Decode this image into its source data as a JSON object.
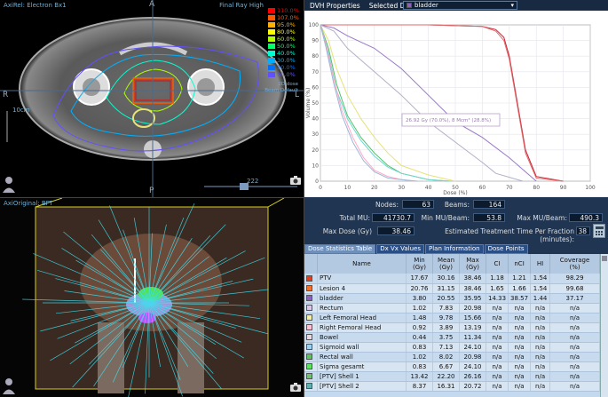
{
  "ct_view": {
    "top_left": "AxiRel: Electron Bx1",
    "top_right": "Final Ray High",
    "orient_top": "A",
    "orient_left": "R",
    "orient_right": "L",
    "orient_bottom": "P",
    "scale_label": "10cm",
    "slice_number": "222",
    "isodose_levels": [
      {
        "label": "110.0%",
        "color": "#ff0000"
      },
      {
        "label": "107.0%",
        "color": "#ff5a00"
      },
      {
        "label": "95.0%",
        "color": "#ffb000"
      },
      {
        "label": "80.0%",
        "color": "#ffff00"
      },
      {
        "label": "60.0%",
        "color": "#b0ff00"
      },
      {
        "label": "50.0%",
        "color": "#00ff66"
      },
      {
        "label": "40.0%",
        "color": "#00ffd0"
      },
      {
        "label": "30.0%",
        "color": "#00b0ff"
      },
      {
        "label": "20.0%",
        "color": "#0070ff"
      },
      {
        "label": "10.0%",
        "color": "#6050ff"
      }
    ],
    "overlay_note_1": "2D dose",
    "overlay_note_2": "Beam Default"
  },
  "view3d": {
    "top_left": "AxiOriginal: BFT"
  },
  "dvh": {
    "panel_title": "DVH Properties",
    "selected_label": "Selected DVH:",
    "selected_value": "bladder",
    "cursor_readout": "26.92 Gy (70.0%), 8 Mcm³ (28.8%)",
    "xlabel": "Dose (%)",
    "ylabel": "Volume (%)"
  },
  "chart_data": {
    "type": "line",
    "xlabel": "Dose (%)",
    "ylabel": "Volume (%)",
    "xlim": [
      0,
      100
    ],
    "ylim": [
      0,
      100
    ],
    "x_ticks": [
      0,
      10,
      20,
      30,
      40,
      50,
      60,
      70,
      80,
      90,
      100
    ],
    "y_ticks": [
      0,
      10,
      20,
      30,
      40,
      50,
      60,
      70,
      80,
      90,
      100
    ],
    "series": [
      {
        "color": "#cc2233",
        "x": [
          0,
          40,
          60,
          65,
          68,
          70,
          73,
          76,
          80,
          90
        ],
        "y": [
          100,
          100,
          99,
          97,
          92,
          80,
          50,
          20,
          3,
          0
        ]
      },
      {
        "color": "#e06a6a",
        "x": [
          0,
          40,
          60,
          65,
          68,
          70,
          73,
          76,
          80,
          90
        ],
        "y": [
          100,
          100,
          99,
          96,
          90,
          78,
          48,
          18,
          2,
          0
        ]
      },
      {
        "color": "#9a78c8",
        "x": [
          0,
          5,
          10,
          20,
          30,
          40,
          50,
          60,
          70,
          80
        ],
        "y": [
          100,
          98,
          93,
          85,
          72,
          55,
          38,
          28,
          15,
          0
        ]
      },
      {
        "color": "#b0b0c8",
        "x": [
          0,
          5,
          10,
          20,
          30,
          40,
          50,
          60,
          65,
          75
        ],
        "y": [
          100,
          96,
          85,
          70,
          55,
          38,
          25,
          12,
          5,
          0
        ]
      },
      {
        "color": "#e7e27a",
        "x": [
          0,
          3,
          6,
          10,
          15,
          20,
          25,
          30,
          40,
          50
        ],
        "y": [
          100,
          90,
          72,
          55,
          40,
          28,
          18,
          10,
          4,
          0
        ]
      },
      {
        "color": "#4fbf6a",
        "x": [
          0,
          3,
          6,
          10,
          15,
          20,
          25,
          30,
          40,
          48
        ],
        "y": [
          100,
          85,
          62,
          42,
          28,
          18,
          10,
          5,
          1,
          0
        ]
      },
      {
        "color": "#6fd6d0",
        "x": [
          0,
          3,
          6,
          10,
          15,
          20,
          25,
          30,
          40,
          48
        ],
        "y": [
          100,
          82,
          58,
          40,
          26,
          16,
          9,
          5,
          1,
          0
        ]
      },
      {
        "color": "#ffa8c8",
        "x": [
          0,
          2,
          5,
          8,
          12,
          16,
          20,
          25,
          30,
          35
        ],
        "y": [
          100,
          88,
          65,
          45,
          28,
          15,
          7,
          3,
          1,
          0
        ]
      },
      {
        "color": "#9bb8d8",
        "x": [
          0,
          2,
          5,
          8,
          12,
          16,
          20,
          25,
          30,
          36
        ],
        "y": [
          100,
          86,
          62,
          42,
          25,
          13,
          6,
          2,
          1,
          0
        ]
      }
    ]
  },
  "stats": {
    "nodes_label": "Nodes:",
    "nodes_value": "63",
    "beams_label": "Beams:",
    "beams_value": "164",
    "total_mu_label": "Total MU:",
    "total_mu_value": "41730.7",
    "min_mu_label": "Min MU/Beam:",
    "min_mu_value": "53.8",
    "max_mu_label": "Max MU/Beam:",
    "max_mu_value": "490.3",
    "max_dose_label": "Max Dose (Gy)",
    "max_dose_value": "38.46",
    "ett_label": "Estimated Treatment Time Per Fraction (minutes):",
    "ett_value": "38"
  },
  "tabs": [
    "Dose Statistics Table",
    "Dx Vx Values",
    "Plan Information",
    "Dose Points"
  ],
  "table": {
    "headers": [
      "Name",
      "Min\n(Gy)",
      "Mean\n(Gy)",
      "Max\n(Gy)",
      "CI",
      "nCI",
      "HI",
      "Coverage\n(%)"
    ],
    "rows": [
      {
        "color": "#e04020",
        "name": "PTV",
        "min": "17.67",
        "mean": "30.16",
        "max": "38.46",
        "ci": "1.18",
        "nci": "1.21",
        "hi": "1.54",
        "cov": "98.29"
      },
      {
        "color": "#f07030",
        "name": "Lesion 4",
        "min": "20.76",
        "mean": "31.15",
        "max": "38.46",
        "ci": "1.65",
        "nci": "1.66",
        "hi": "1.54",
        "cov": "99.68"
      },
      {
        "color": "#8a60c0",
        "name": "bladder",
        "min": "3.80",
        "mean": "20.55",
        "max": "35.95",
        "ci": "14.33",
        "nci": "38.57",
        "hi": "1.44",
        "cov": "37.17"
      },
      {
        "color": "#d9c7e8",
        "name": "Rectum",
        "min": "1.02",
        "mean": "7.83",
        "max": "20.98",
        "ci": "n/a",
        "nci": "n/a",
        "hi": "n/a",
        "cov": "n/a"
      },
      {
        "color": "#f5f0a0",
        "name": "Left Femoral Head",
        "min": "1.48",
        "mean": "9.78",
        "max": "15.66",
        "ci": "n/a",
        "nci": "n/a",
        "hi": "n/a",
        "cov": "n/a"
      },
      {
        "color": "#ffc0d0",
        "name": "Right Femoral Head",
        "min": "0.92",
        "mean": "3.89",
        "max": "13.19",
        "ci": "n/a",
        "nci": "n/a",
        "hi": "n/a",
        "cov": "n/a"
      },
      {
        "color": "#e8d8e0",
        "name": "Bowel",
        "min": "0.44",
        "mean": "3.75",
        "max": "11.34",
        "ci": "n/a",
        "nci": "n/a",
        "hi": "n/a",
        "cov": "n/a"
      },
      {
        "color": "#a0d0f0",
        "name": "Sigmoid wall",
        "min": "0.83",
        "mean": "7.13",
        "max": "24.10",
        "ci": "n/a",
        "nci": "n/a",
        "hi": "n/a",
        "cov": "n/a"
      },
      {
        "color": "#5fbf60",
        "name": "Rectal wall",
        "min": "1.02",
        "mean": "8.02",
        "max": "20.98",
        "ci": "n/a",
        "nci": "n/a",
        "hi": "n/a",
        "cov": "n/a"
      },
      {
        "color": "#60e060",
        "name": "Sigma gesamt",
        "min": "0.83",
        "mean": "6.67",
        "max": "24.10",
        "ci": "n/a",
        "nci": "n/a",
        "hi": "n/a",
        "cov": "n/a"
      },
      {
        "color": "#70c070",
        "name": "[PTV] Shell 1",
        "min": "13.42",
        "mean": "22.20",
        "max": "26.16",
        "ci": "n/a",
        "nci": "n/a",
        "hi": "n/a",
        "cov": "n/a"
      },
      {
        "color": "#60b0b0",
        "name": "[PTV] Shell 2",
        "min": "8.37",
        "mean": "16.31",
        "max": "20.72",
        "ci": "n/a",
        "nci": "n/a",
        "hi": "n/a",
        "cov": "n/a"
      }
    ]
  },
  "icons": {
    "camera": "camera-icon",
    "patient": "patient-orientation-icon",
    "calculator": "calculator-icon",
    "dropdown": "chevron-down-icon"
  }
}
